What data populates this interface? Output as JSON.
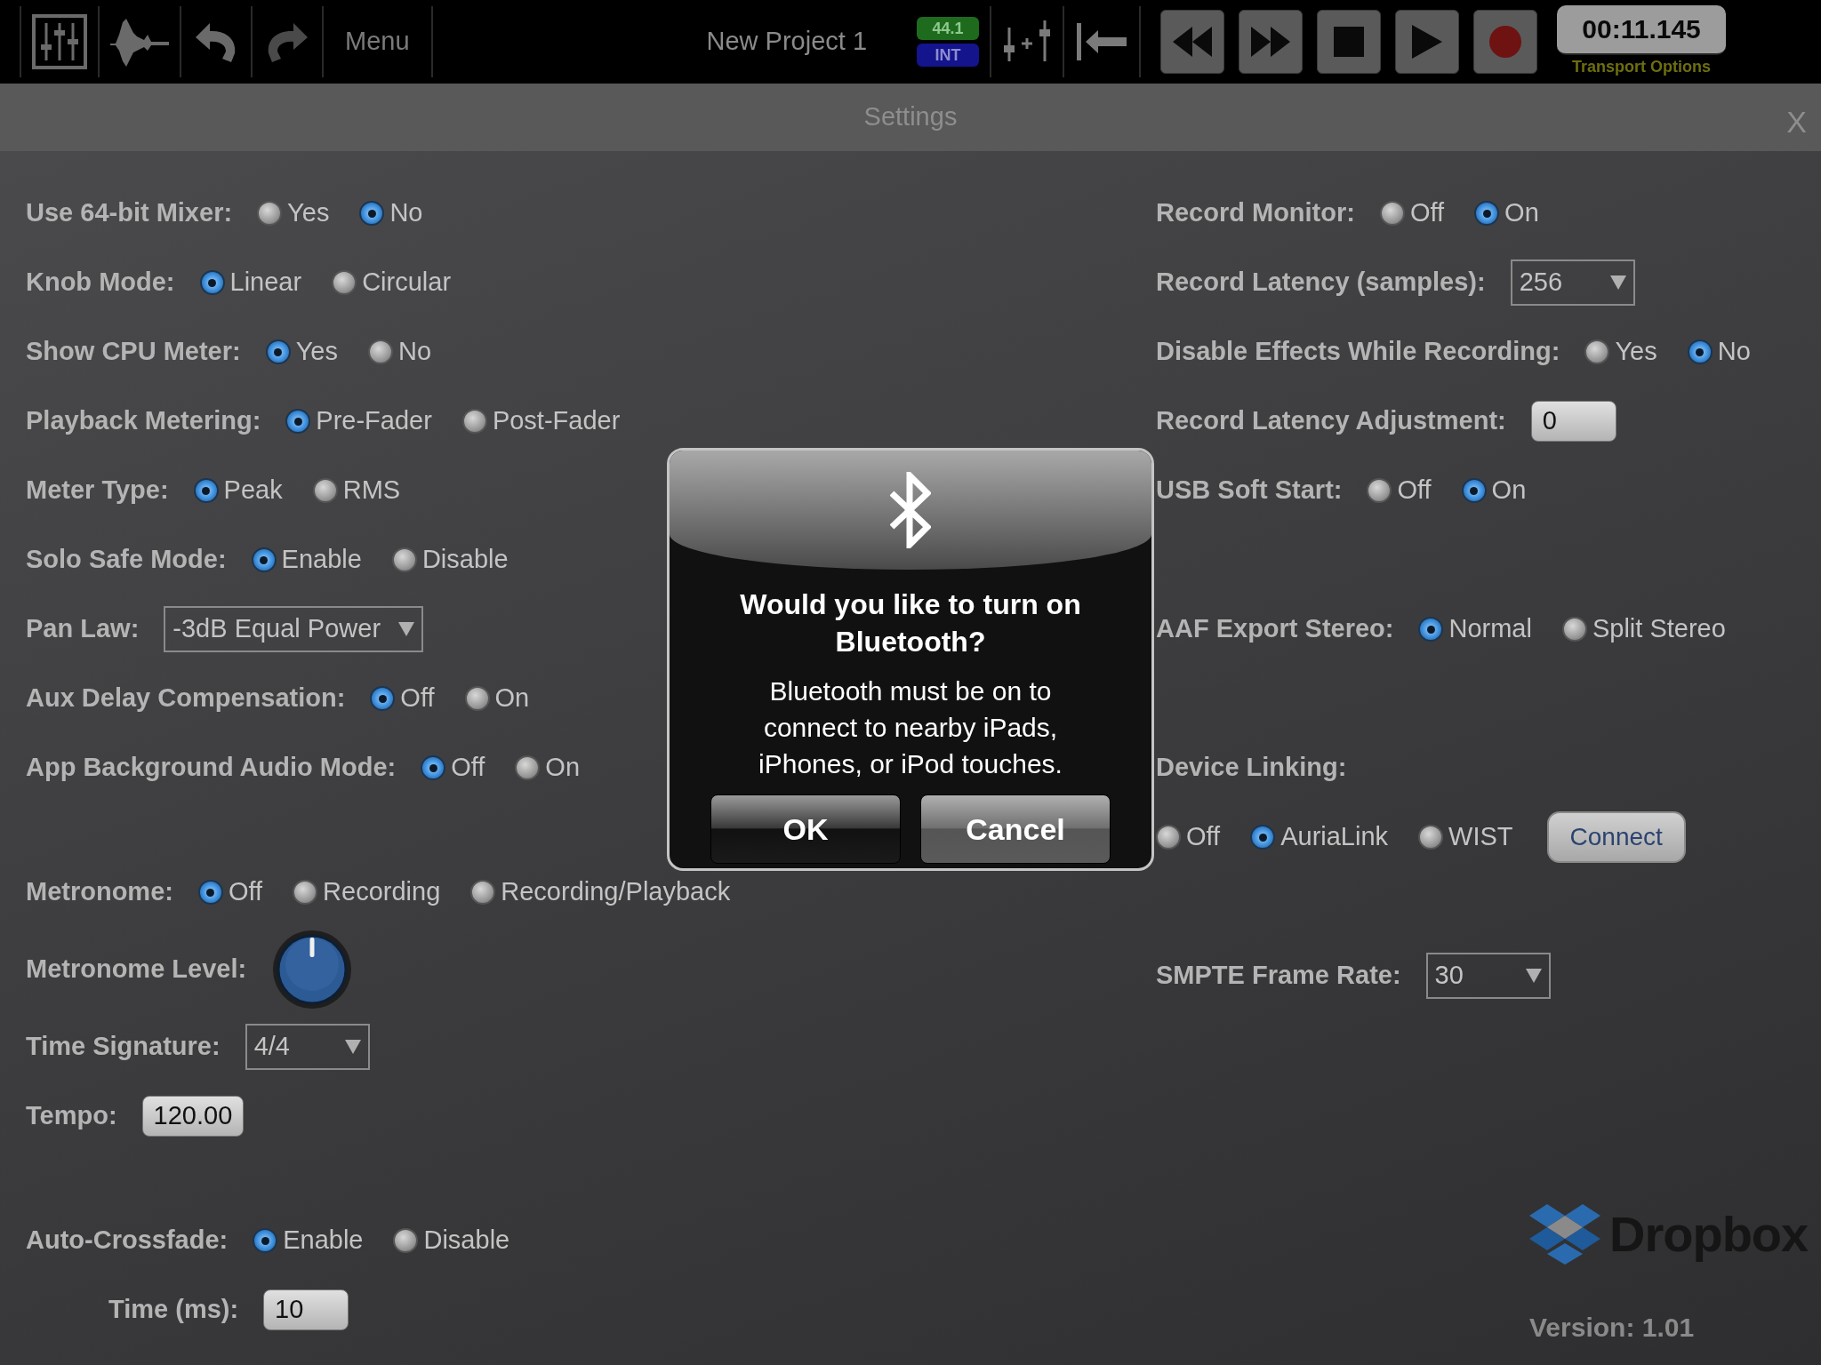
{
  "toolbar": {
    "menu": "Menu",
    "project_title": "New Project 1",
    "sample_rate": "44.1",
    "clock_source": "INT",
    "time": "00:11.145",
    "transport_label": "Transport Options"
  },
  "settings": {
    "title": "Settings",
    "close": "X",
    "left_groups": [
      [
        {
          "kind": "radio",
          "label": "Use 64-bit Mixer:",
          "options": [
            {
              "label": "Yes",
              "selected": false
            },
            {
              "label": "No",
              "selected": true
            }
          ]
        },
        {
          "kind": "radio",
          "label": "Knob Mode:",
          "options": [
            {
              "label": "Linear",
              "selected": true
            },
            {
              "label": "Circular",
              "selected": false
            }
          ]
        },
        {
          "kind": "radio",
          "label": "Show CPU Meter:",
          "options": [
            {
              "label": "Yes",
              "selected": true
            },
            {
              "label": "No",
              "selected": false
            }
          ]
        },
        {
          "kind": "radio",
          "label": "Playback Metering:",
          "options": [
            {
              "label": "Pre-Fader",
              "selected": true
            },
            {
              "label": "Post-Fader",
              "selected": false
            }
          ]
        },
        {
          "kind": "radio",
          "label": "Meter Type:",
          "options": [
            {
              "label": "Peak",
              "selected": true
            },
            {
              "label": "RMS",
              "selected": false
            }
          ]
        },
        {
          "kind": "radio",
          "label": "Solo Safe Mode:",
          "options": [
            {
              "label": "Enable",
              "selected": true
            },
            {
              "label": "Disable",
              "selected": false
            }
          ]
        },
        {
          "kind": "dropdown",
          "label": "Pan Law:",
          "value": "-3dB Equal Power"
        },
        {
          "kind": "radio",
          "label": "Aux Delay Compensation:",
          "options": [
            {
              "label": "Off",
              "selected": true
            },
            {
              "label": "On",
              "selected": false
            }
          ]
        },
        {
          "kind": "radio",
          "label": "App Background Audio Mode:",
          "options": [
            {
              "label": "Off",
              "selected": true
            },
            {
              "label": "On",
              "selected": false
            }
          ]
        }
      ],
      [
        {
          "kind": "radio",
          "label": "Metronome:",
          "options": [
            {
              "label": "Off",
              "selected": true
            },
            {
              "label": "Recording",
              "selected": false
            },
            {
              "label": "Recording/Playback",
              "selected": false
            }
          ]
        },
        {
          "kind": "knob",
          "label": "Metronome Level:"
        },
        {
          "kind": "dropdown",
          "label": "Time Signature:",
          "value": "4/4"
        },
        {
          "kind": "field",
          "label": "Tempo:",
          "value": "120.00"
        }
      ],
      [
        {
          "kind": "radio",
          "label": "Auto-Crossfade:",
          "options": [
            {
              "label": "Enable",
              "selected": true
            },
            {
              "label": "Disable",
              "selected": false
            }
          ]
        },
        {
          "kind": "field",
          "label": "Time (ms):",
          "value": "10",
          "indent": true
        }
      ]
    ],
    "right_groups": [
      [
        {
          "kind": "radio",
          "label": "Record Monitor:",
          "options": [
            {
              "label": "Off",
              "selected": false
            },
            {
              "label": "On",
              "selected": true
            }
          ]
        },
        {
          "kind": "dropdown",
          "label": "Record Latency (samples):",
          "value": "256"
        },
        {
          "kind": "radio",
          "label": "Disable Effects While Recording:",
          "options": [
            {
              "label": "Yes",
              "selected": false
            },
            {
              "label": "No",
              "selected": true
            }
          ]
        },
        {
          "kind": "field",
          "label": "Record Latency Adjustment:",
          "value": "0"
        },
        {
          "kind": "radio",
          "label": "USB Soft Start:",
          "options": [
            {
              "label": "Off",
              "selected": false
            },
            {
              "label": "On",
              "selected": true
            }
          ]
        }
      ],
      [
        {
          "kind": "radio",
          "label": "AAF Export Stereo:",
          "options": [
            {
              "label": "Normal",
              "selected": true
            },
            {
              "label": "Split Stereo",
              "selected": false
            }
          ]
        }
      ],
      [
        {
          "kind": "heading",
          "label": "Device Linking:"
        },
        {
          "kind": "radio",
          "options": [
            {
              "label": "Off",
              "selected": false
            },
            {
              "label": "AuriaLink",
              "selected": true
            },
            {
              "label": "WIST",
              "selected": false
            }
          ],
          "button": "Connect"
        }
      ],
      [
        {
          "kind": "dropdown",
          "label": "SMPTE Frame Rate:",
          "value": "30"
        }
      ]
    ]
  },
  "footer": {
    "logo_text": "Dropbox",
    "version": "Version: 1.01"
  },
  "dialog": {
    "title": "Would you like to turn on Bluetooth?",
    "message": "Bluetooth must be on to connect to nearby iPads, iPhones, or iPod touches.",
    "buttons": [
      {
        "label": "OK",
        "kind": "dark"
      },
      {
        "label": "Cancel",
        "kind": "light"
      }
    ]
  }
}
